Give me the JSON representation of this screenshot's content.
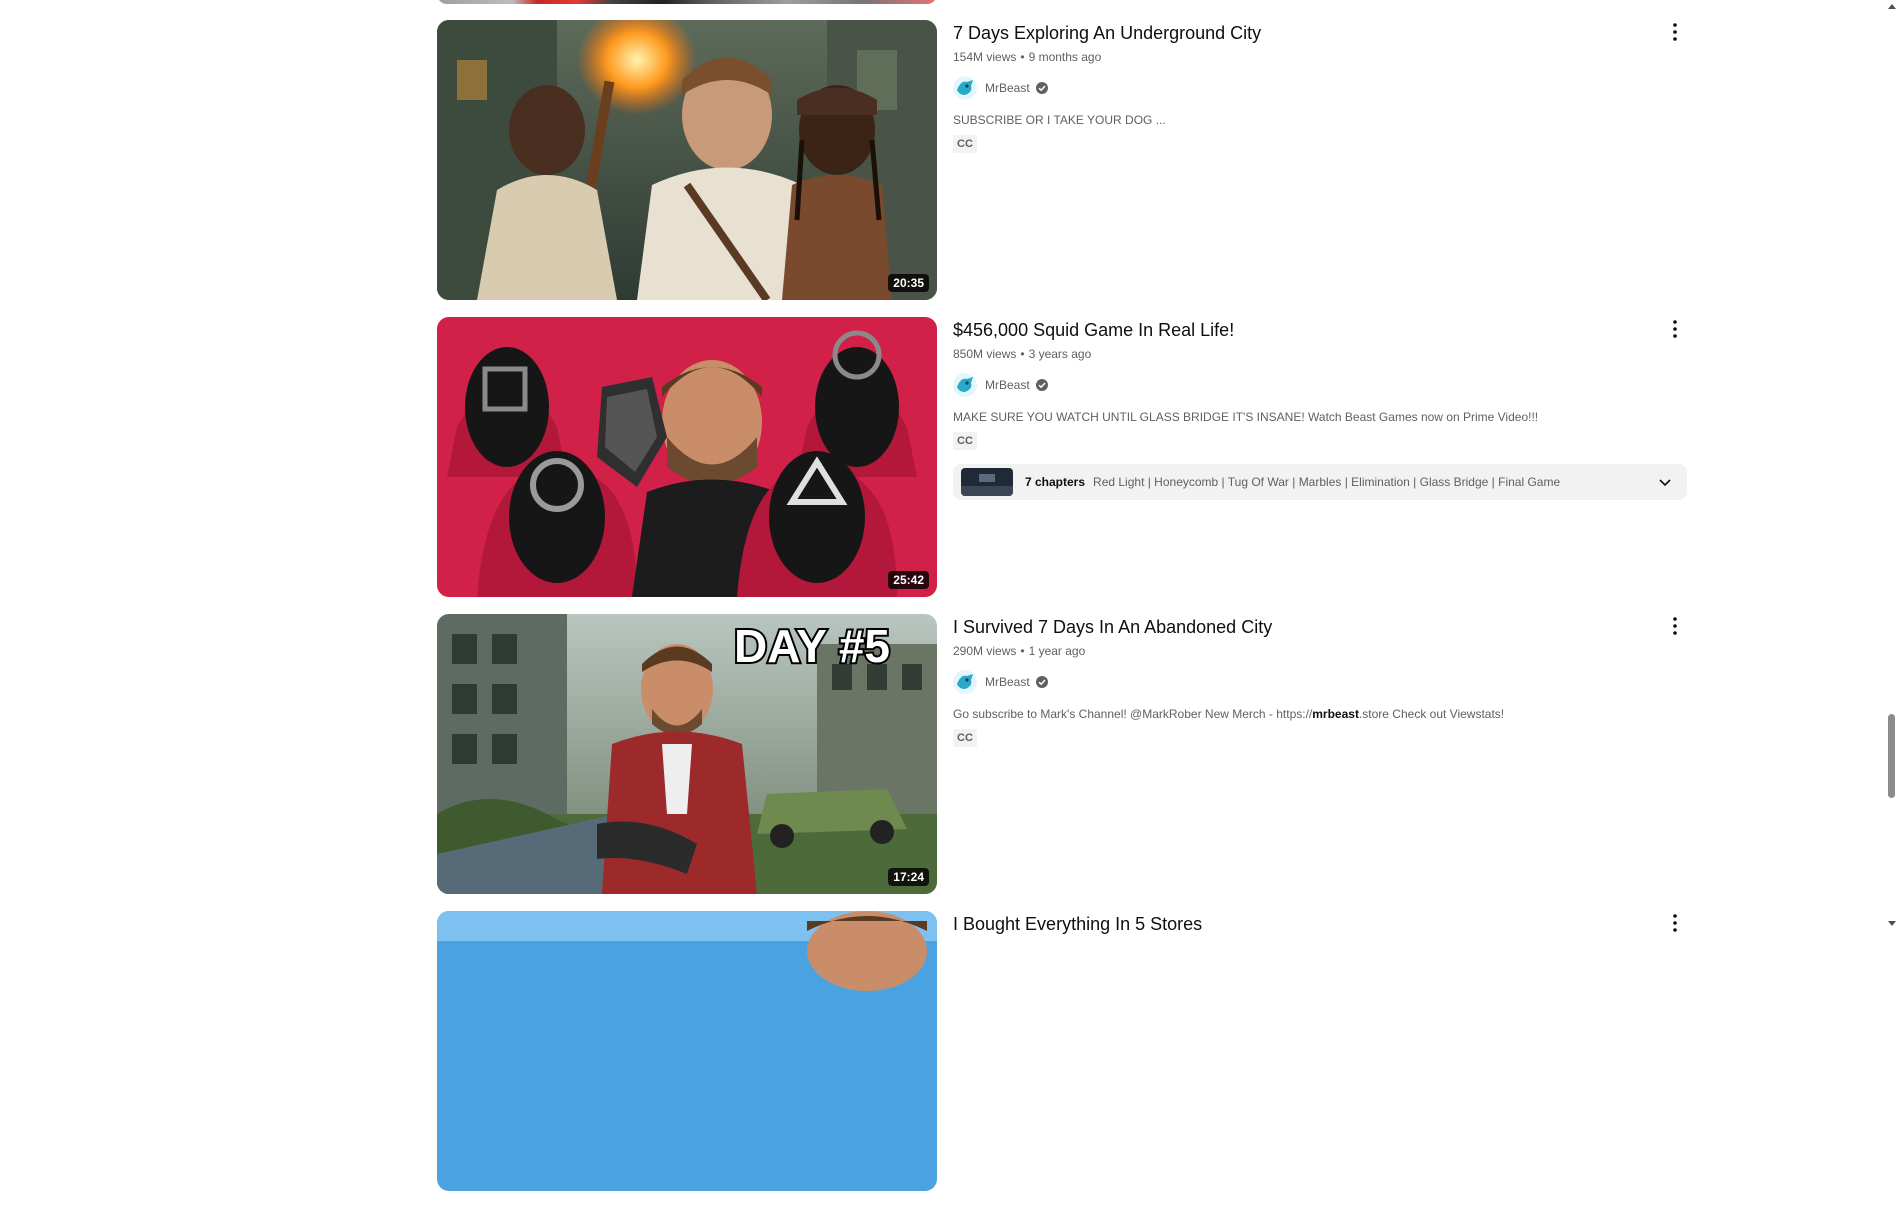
{
  "results": [
    {
      "title": "7 Days Exploring An Underground City",
      "views": "154M views",
      "age": "9 months ago",
      "channel": "MrBeast",
      "description": "SUBSCRIBE OR I TAKE YOUR DOG ...",
      "badge": "CC",
      "duration": "20:35"
    },
    {
      "title": "$456,000 Squid Game In Real Life!",
      "views": "850M views",
      "age": "3 years ago",
      "channel": "MrBeast",
      "description": "MAKE SURE YOU WATCH UNTIL GLASS BRIDGE IT'S INSANE! Watch Beast Games now on Prime Video!!!",
      "badge": "CC",
      "duration": "25:42",
      "chapters": {
        "count": "7 chapters",
        "list": "Red Light | Honeycomb | Tug Of War | Marbles | Elimination | Glass Bridge | Final Game"
      }
    },
    {
      "title": "I Survived 7 Days In An Abandoned City",
      "views": "290M views",
      "age": "1 year ago",
      "channel": "MrBeast",
      "description_before": "Go subscribe to Mark's Channel! @MarkRober New Merch - https://",
      "description_bold": "mrbeast",
      "description_after": ".store Check out Viewstats!",
      "badge": "CC",
      "duration": "17:24",
      "thumb_overlay": "DAY #5"
    },
    {
      "title": "I Bought Everything In 5 Stores"
    }
  ],
  "meta_separator": "•",
  "colors": {
    "primary_text": "#0f0f0f",
    "secondary_text": "#606060",
    "chip_bg": "#f2f2f2",
    "scrollbar": "#8c8c8c"
  },
  "icons": {
    "menu": "more-vert-icon",
    "verified": "verified-check-icon",
    "chevron": "chevron-down-icon"
  }
}
